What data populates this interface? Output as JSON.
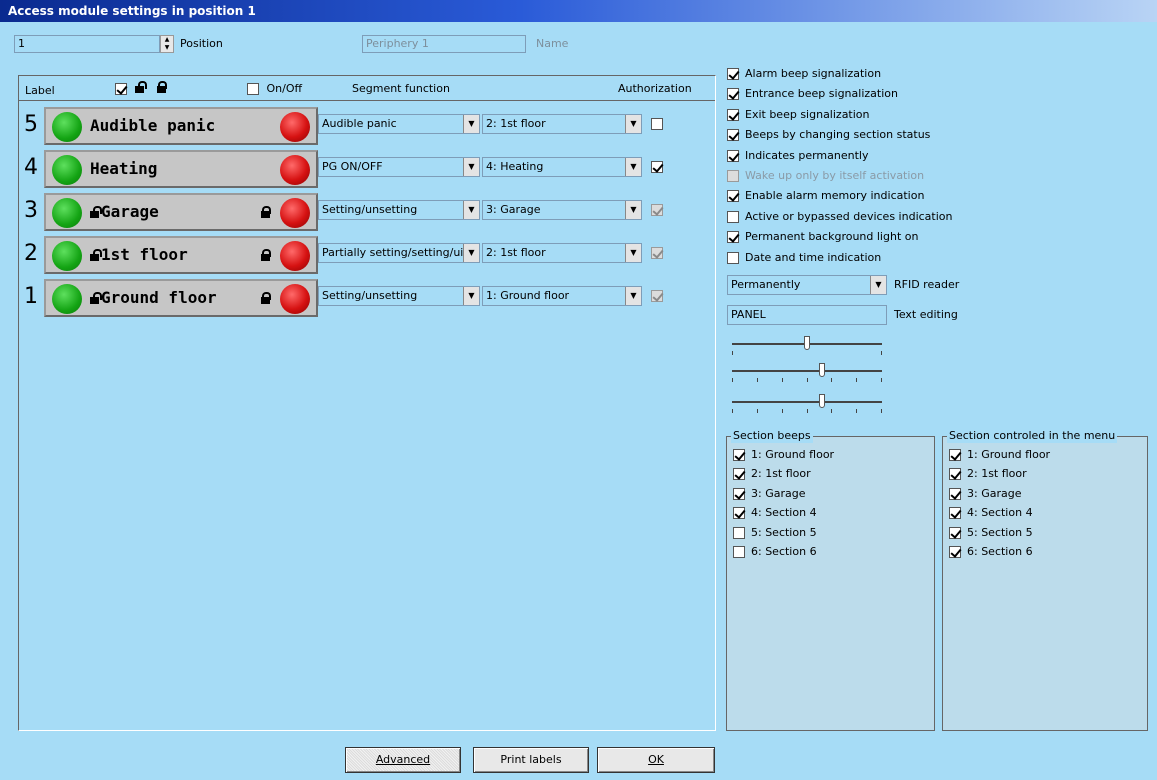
{
  "window": {
    "title": "Access module settings in position 1"
  },
  "position": {
    "value": "1",
    "label": "Position"
  },
  "name": {
    "value": "Periphery 1",
    "label": "Name"
  },
  "table": {
    "col_label": "Label",
    "col_onoff": "On/Off",
    "col_segment": "Segment function",
    "col_auth": "Authorization"
  },
  "segments": [
    {
      "num": "5",
      "text": "Audible panic",
      "lock": false,
      "function": "Audible panic",
      "section": "2: 1st floor",
      "auth": true,
      "auth_checked": false
    },
    {
      "num": "4",
      "text": "Heating",
      "lock": false,
      "function": "PG ON/OFF",
      "section": "4: Heating",
      "auth": true,
      "auth_checked": true
    },
    {
      "num": "3",
      "text": "Garage",
      "lock": true,
      "function": "Setting/unsetting",
      "section": "3: Garage",
      "auth": false,
      "auth_checked": true
    },
    {
      "num": "2",
      "text": "1st floor",
      "lock": true,
      "function": "Partially setting/setting/ui",
      "section": "2: 1st floor",
      "auth": false,
      "auth_checked": true
    },
    {
      "num": "1",
      "text": "Ground floor",
      "lock": true,
      "function": "Setting/unsetting",
      "section": "1: Ground floor",
      "auth": false,
      "auth_checked": true
    }
  ],
  "options": [
    {
      "label": "Alarm beep signalization",
      "checked": true,
      "enabled": true
    },
    {
      "label": "Entrance beep signalization",
      "checked": true,
      "enabled": true
    },
    {
      "label": "Exit beep signalization",
      "checked": true,
      "enabled": true
    },
    {
      "label": "Beeps by changing section status",
      "checked": true,
      "enabled": true
    },
    {
      "label": "Indicates permanently",
      "checked": true,
      "enabled": true
    },
    {
      "label": "Wake up only by itself activation",
      "checked": false,
      "enabled": false
    },
    {
      "label": "Enable alarm memory indication",
      "checked": true,
      "enabled": true
    },
    {
      "label": "Active or bypassed devices indication",
      "checked": false,
      "enabled": true
    },
    {
      "label": "Permanent background light on",
      "checked": true,
      "enabled": true
    },
    {
      "label": "Date and time indication",
      "checked": false,
      "enabled": true
    }
  ],
  "rfid": {
    "value": "Permanently",
    "label": "RFID reader"
  },
  "text_editing": {
    "value": "PANEL",
    "label": "Text editing"
  },
  "sliders": [
    {
      "level": 0.5,
      "ticks": 2
    },
    {
      "level": 0.6,
      "ticks": 7
    },
    {
      "level": 0.6,
      "ticks": 7
    }
  ],
  "section_beeps": {
    "title": "Section beeps",
    "items": [
      {
        "label": "1: Ground floor",
        "checked": true
      },
      {
        "label": "2: 1st floor",
        "checked": true
      },
      {
        "label": "3: Garage",
        "checked": true
      },
      {
        "label": "4: Section 4",
        "checked": true
      },
      {
        "label": "5: Section 5",
        "checked": false
      },
      {
        "label": "6: Section 6",
        "checked": false
      }
    ]
  },
  "section_menu": {
    "title": "Section controled in the menu",
    "items": [
      {
        "label": "1: Ground floor",
        "checked": true
      },
      {
        "label": "2: 1st floor",
        "checked": true
      },
      {
        "label": "3: Garage",
        "checked": true
      },
      {
        "label": "4: Section 4",
        "checked": true
      },
      {
        "label": "5: Section 5",
        "checked": true
      },
      {
        "label": "6: Section 6",
        "checked": true
      }
    ]
  },
  "buttons": {
    "advanced": "Advanced",
    "print": "Print labels",
    "ok": "OK"
  }
}
